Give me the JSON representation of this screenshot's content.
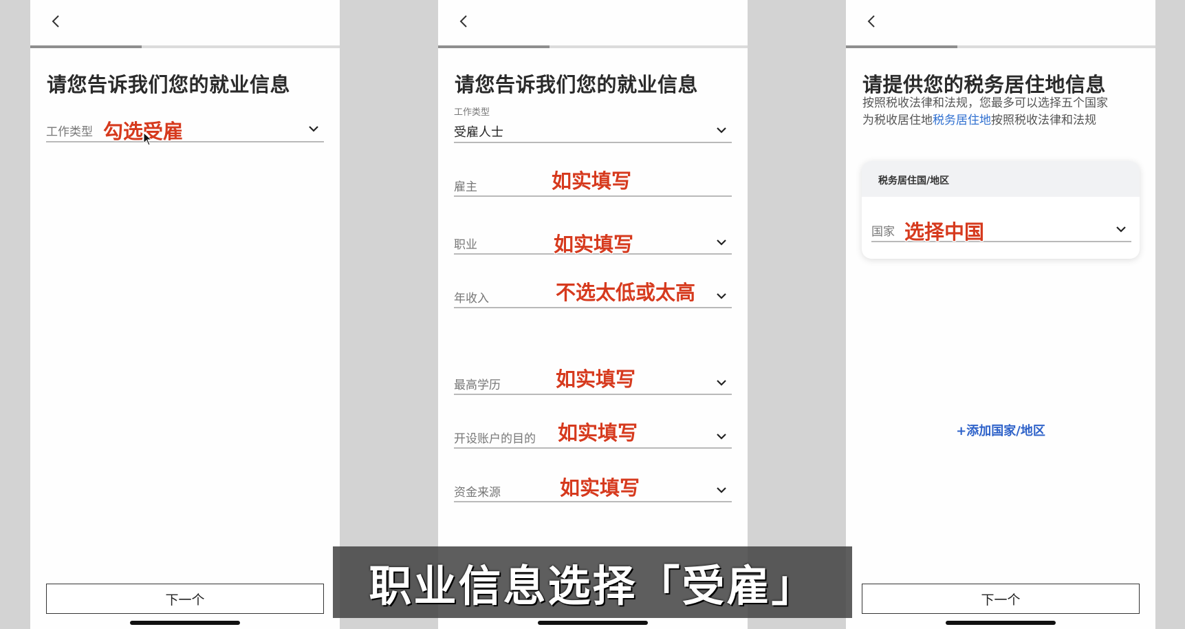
{
  "screen1": {
    "title": "请您告诉我们您的就业信息",
    "progress_fraction": 0.36,
    "field": {
      "label": "工作类型",
      "annotation": "勾选受雇"
    },
    "next_label": "下一个"
  },
  "screen2": {
    "title": "请您告诉我们您的就业信息",
    "progress_fraction": 0.36,
    "job_type": {
      "label": "工作类型",
      "value": "受雇人士"
    },
    "fields": [
      {
        "label": "雇主",
        "annotation": "如实填写"
      },
      {
        "label": "职业",
        "annotation": "如实填写"
      },
      {
        "label": "年收入",
        "annotation": "不选太低或太高"
      },
      {
        "label": "最高学历",
        "annotation": "如实填写"
      },
      {
        "label": "开设账户的目的",
        "annotation": "如实填写"
      },
      {
        "label": "资金来源",
        "annotation": "如实填写"
      }
    ]
  },
  "screen3": {
    "title": "请提供您的税务居住地信息",
    "progress_fraction": 0.36,
    "subtitle_line1": "按照税收法律和法规，您最多可以选择五个国家",
    "subtitle_line2_pre": "为税收居住地",
    "subtitle_link": "税务居住地",
    "subtitle_line2_post": "按照税收法律和法规",
    "card_header": "税务居住国/地区",
    "country_label": "国家",
    "country_annotation": "选择中国",
    "add_country": "+添加国家/地区",
    "next_label": "下一个"
  },
  "caption": "职业信息选择「受雇」",
  "colors": {
    "annotation": "#d63a1e",
    "link": "#2e6fd0",
    "caption_bg": "#444444"
  }
}
